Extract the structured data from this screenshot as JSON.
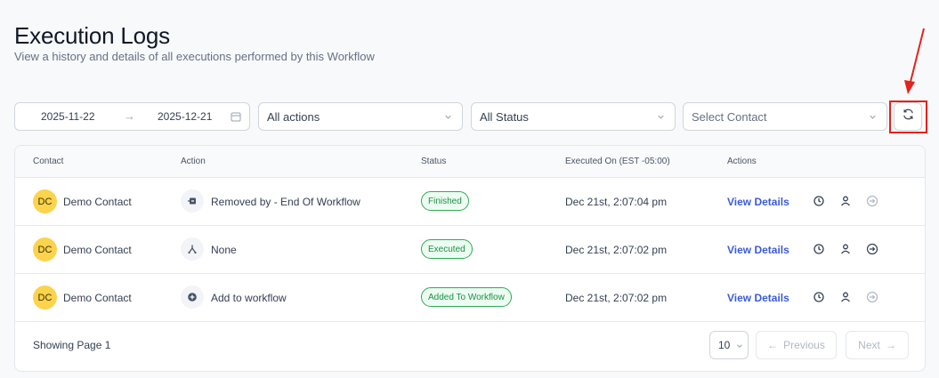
{
  "header": {
    "title": "Execution Logs",
    "subtitle": "View a history and details of all executions performed by this Workflow"
  },
  "filters": {
    "date_start": "2025-11-22",
    "date_end": "2025-12-21",
    "action_filter": "All actions",
    "status_filter": "All Status",
    "contact_placeholder": "Select Contact"
  },
  "table": {
    "columns": [
      "Contact",
      "Action",
      "Status",
      "Executed On (EST -05:00)",
      "Actions"
    ],
    "rows": [
      {
        "avatar_initials": "DC",
        "contact": "Demo Contact",
        "action_icon": "remove-from-workflow-icon",
        "action": "Removed by - End Of Workflow",
        "status": "Finished",
        "executed_on": "Dec 21st, 2:07:04 pm",
        "view_label": "View Details",
        "exit_icon_disabled": true
      },
      {
        "avatar_initials": "DC",
        "contact": "Demo Contact",
        "action_icon": "branch-icon",
        "action": "None",
        "status": "Executed",
        "executed_on": "Dec 21st, 2:07:02 pm",
        "view_label": "View Details",
        "exit_icon_disabled": false
      },
      {
        "avatar_initials": "DC",
        "contact": "Demo Contact",
        "action_icon": "add-circle-icon",
        "action": "Add to workflow",
        "status": "Added To Workflow",
        "executed_on": "Dec 21st, 2:07:02 pm",
        "view_label": "View Details",
        "exit_icon_disabled": true
      }
    ]
  },
  "footer": {
    "showing_text": "Showing Page 1",
    "page_size": "10",
    "prev_label": "Previous",
    "next_label": "Next"
  },
  "colors": {
    "accent_link": "#3b5bdb",
    "badge_green": "#1e8e3e",
    "avatar_yellow": "#fcd34d",
    "annotation_red": "#e3231c"
  }
}
